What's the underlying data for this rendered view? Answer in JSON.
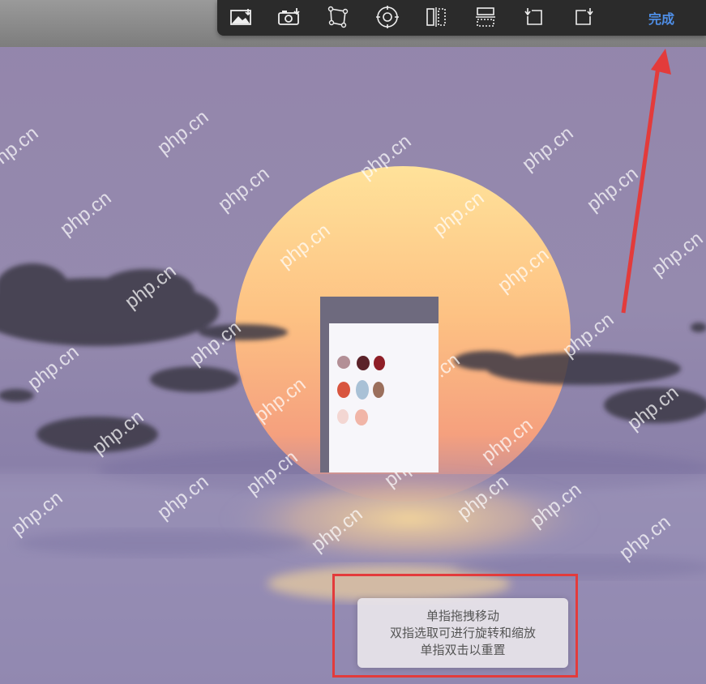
{
  "toolbar": {
    "tools": [
      {
        "icon": "image-import-icon"
      },
      {
        "icon": "camera-import-icon"
      },
      {
        "icon": "free-transform-icon"
      },
      {
        "icon": "warp-target-icon"
      },
      {
        "icon": "flip-horizontal-icon"
      },
      {
        "icon": "flip-vertical-icon"
      },
      {
        "icon": "rotate-left-icon"
      },
      {
        "icon": "rotate-right-icon"
      }
    ],
    "done_label": "完成"
  },
  "toast": {
    "lines": [
      "单指拖拽移动",
      "双指选取可进行旋转和缩放",
      "单指双击以重置"
    ]
  },
  "palette": {
    "swatch_colors": [
      "#b38f96",
      "#5b2229",
      "#8f1e27",
      "#d8553f",
      "#a9c1d6",
      "#9b6f5c",
      "#f3d6d2",
      "#f1b5a7"
    ]
  },
  "watermark": {
    "text": "php.cn"
  },
  "colors": {
    "annotation_red": "#e33b3b",
    "done_blue": "#4f8fe8",
    "toolbar_bg": "#2b2b2b"
  }
}
